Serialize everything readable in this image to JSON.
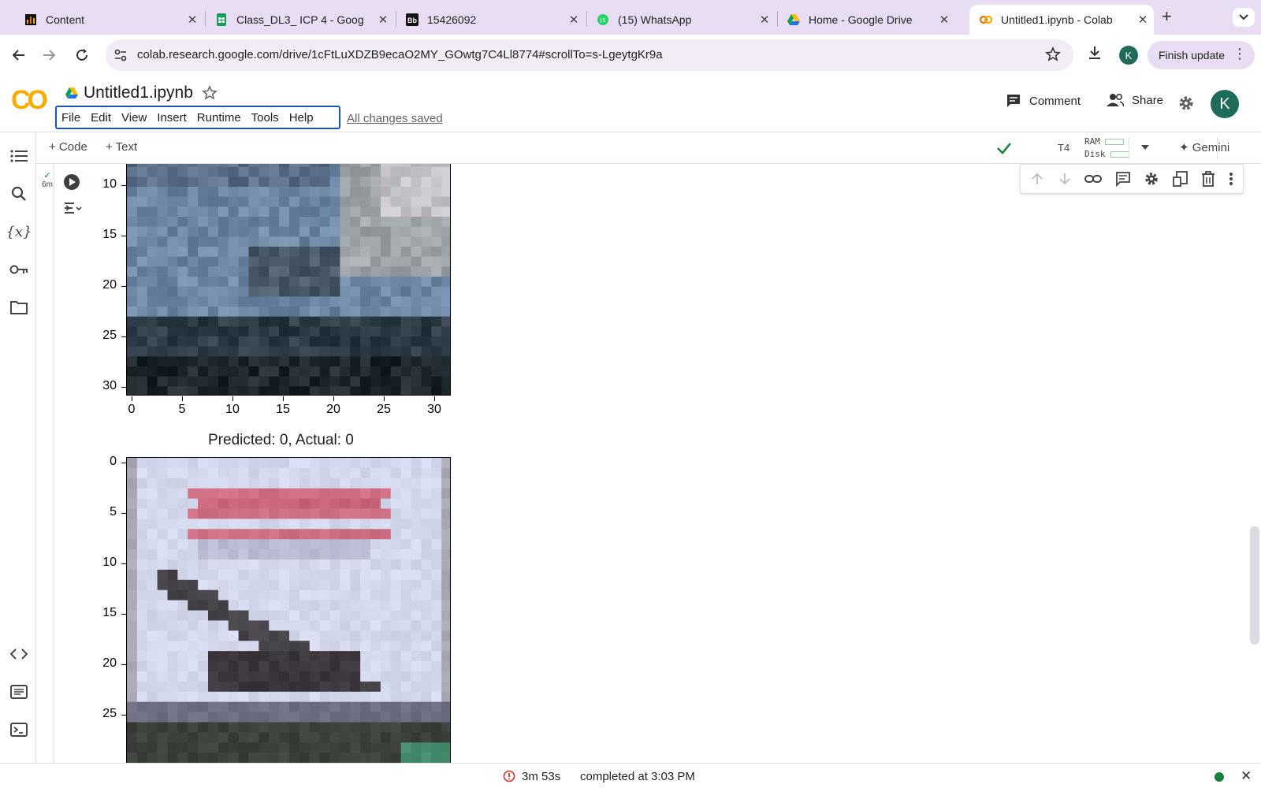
{
  "browser": {
    "tabs": [
      {
        "title": "Content",
        "favicon": "bar-chart-icon",
        "color": "#e37400"
      },
      {
        "title": "Class_DL3_ ICP 4 - Goog",
        "favicon": "sheets-icon",
        "color": "#0f9d58"
      },
      {
        "title": "15426092",
        "favicon": "blackboard-icon",
        "color": "#111111"
      },
      {
        "title": "(15) WhatsApp",
        "favicon": "whatsapp-icon",
        "color": "#25d366"
      },
      {
        "title": "Home - Google Drive",
        "favicon": "drive-icon",
        "color": "#1a73e8"
      },
      {
        "title": "Untitled1.ipynb - Colab",
        "favicon": "colab-icon",
        "color": "#e8710a",
        "active": true
      }
    ],
    "url": "colab.research.google.com/drive/1cFtLuXDZB9ecaO2MY_GOwtg7C4Ll8774#scrollTo=s-LgeytgKr9a",
    "profile_initial": "K",
    "finish_update_label": "Finish update"
  },
  "colab": {
    "notebook_name": "Untitled1.ipynb",
    "menu": [
      "File",
      "Edit",
      "View",
      "Insert",
      "Runtime",
      "Tools",
      "Help"
    ],
    "save_status": "All changes saved",
    "comment_label": "Comment",
    "share_label": "Share",
    "avatar_initial": "K",
    "add_code_label": "+ Code",
    "add_text_label": "+ Text",
    "runtime_type": "T4",
    "ram_label": "RAM",
    "disk_label": "Disk",
    "gemini_label": "Gemini",
    "exec_time": "6m"
  },
  "output": {
    "plot1": {
      "yticks": [
        "10",
        "15",
        "20",
        "25",
        "30"
      ],
      "xticks": [
        "0",
        "5",
        "10",
        "15",
        "20",
        "25",
        "30"
      ]
    },
    "plot2": {
      "title": "Predicted: 0, Actual: 0",
      "yticks": [
        "0",
        "5",
        "10",
        "15",
        "20",
        "25"
      ]
    }
  },
  "status_bar": {
    "duration": "3m 53s",
    "completed": "completed at 3:03 PM"
  }
}
